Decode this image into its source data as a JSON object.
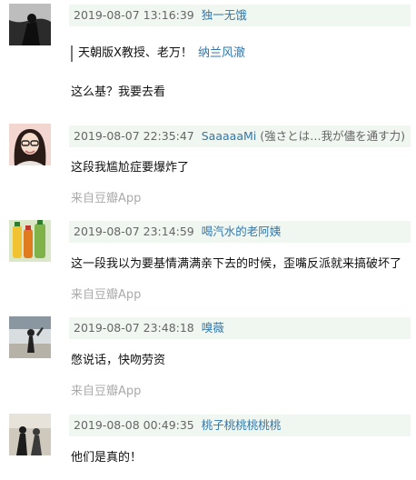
{
  "comments": [
    {
      "time": "2019-08-07 13:16:39",
      "user": "独一无饿",
      "quote_text": "天朝版X教授、老万！",
      "quote_author": "纳兰风澈",
      "text": "这么基？我要去看"
    },
    {
      "time": "2019-08-07 22:35:47",
      "user": "SaaaaaMi",
      "signature": "(強さとは…我が儘を通す力)",
      "text": "这段我尴尬症要爆炸了",
      "from": "来自豆瓣App"
    },
    {
      "time": "2019-08-07 23:14:59",
      "user": "喝汽水的老阿姨",
      "text": "这一段我以为要基情满满亲下去的时候，歪嘴反派就来搞破坏了",
      "from": "来自豆瓣App"
    },
    {
      "time": "2019-08-07 23:48:18",
      "user": "嗅薇",
      "text": "憋说话，快吻劳资",
      "from": "来自豆瓣App"
    },
    {
      "time": "2019-08-08 00:49:35",
      "user": "桃子桃桃桃桃桃",
      "text": "他们是真的！"
    }
  ]
}
